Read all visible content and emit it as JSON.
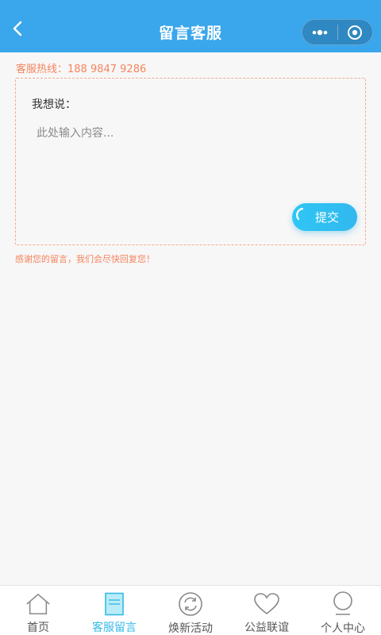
{
  "header": {
    "title": "留言客服",
    "back_icon": "chevron-left-icon",
    "more_icon": "more-dots-icon",
    "close_icon": "target-close-icon",
    "bg_color": "#3aa6ec"
  },
  "hotline": {
    "text": "客服热线：188 9847 9286"
  },
  "message": {
    "label": "我想说：",
    "placeholder": "此处输入内容...",
    "value": "",
    "submit_label": "提交",
    "thanks_text": "感谢您的留言，我们会尽快回复您！"
  },
  "tabbar": {
    "active_color": "#35b9e6",
    "items": [
      {
        "label": "首页",
        "icon": "home-icon",
        "active": false
      },
      {
        "label": "客服留言",
        "icon": "document-icon",
        "active": true
      },
      {
        "label": "焕新活动",
        "icon": "refresh-icon",
        "active": false
      },
      {
        "label": "公益联谊",
        "icon": "heart-icon",
        "active": false
      },
      {
        "label": "个人中心",
        "icon": "user-icon",
        "active": false
      }
    ]
  }
}
